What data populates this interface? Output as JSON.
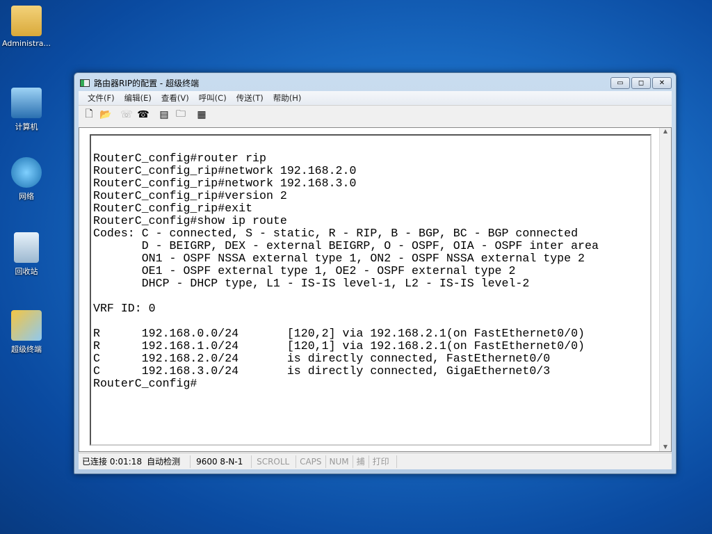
{
  "desktop": {
    "icons": [
      {
        "label": "Administra..."
      },
      {
        "label": "计算机"
      },
      {
        "label": "网络"
      },
      {
        "label": "回收站"
      },
      {
        "label": "超级终端"
      }
    ]
  },
  "window": {
    "title": "路由器RIP的配置 - 超级终端",
    "controls": {
      "minimize": "▭",
      "maximize": "◻",
      "close": "✕"
    }
  },
  "menu": [
    "文件(F)",
    "编辑(E)",
    "查看(V)",
    "呼叫(C)",
    "传送(T)",
    "帮助(H)"
  ],
  "toolbar": [
    {
      "icon": "new-icon",
      "glyph": "🗋"
    },
    {
      "icon": "open-icon",
      "glyph": "📂"
    },
    {
      "icon": "call-icon",
      "glyph": "☏"
    },
    {
      "icon": "disconnect-icon",
      "glyph": "☎"
    },
    {
      "icon": "send-icon",
      "glyph": "▤"
    },
    {
      "icon": "receive-icon",
      "glyph": "🗀"
    },
    {
      "icon": "properties-icon",
      "glyph": "▦"
    }
  ],
  "terminal": {
    "text": "RouterC_config#router rip\nRouterC_config_rip#network 192.168.2.0\nRouterC_config_rip#network 192.168.3.0\nRouterC_config_rip#version 2\nRouterC_config_rip#exit\nRouterC_config#show ip route\nCodes: C - connected, S - static, R - RIP, B - BGP, BC - BGP connected\n       D - BEIGRP, DEX - external BEIGRP, O - OSPF, OIA - OSPF inter area\n       ON1 - OSPF NSSA external type 1, ON2 - OSPF NSSA external type 2\n       OE1 - OSPF external type 1, OE2 - OSPF external type 2\n       DHCP - DHCP type, L1 - IS-IS level-1, L2 - IS-IS level-2\n\nVRF ID: 0\n\nR      192.168.0.0/24       [120,2] via 192.168.2.1(on FastEthernet0/0)\nR      192.168.1.0/24       [120,1] via 192.168.2.1(on FastEthernet0/0)\nC      192.168.2.0/24       is directly connected, FastEthernet0/0\nC      192.168.3.0/24       is directly connected, GigaEthernet0/3\nRouterC_config#"
  },
  "status": {
    "connected": "已连接 0:01:18",
    "detect": "自动检测",
    "port": "9600 8-N-1",
    "scroll": "SCROLL",
    "caps": "CAPS",
    "num": "NUM",
    "capture": "捕",
    "print": "打印"
  }
}
